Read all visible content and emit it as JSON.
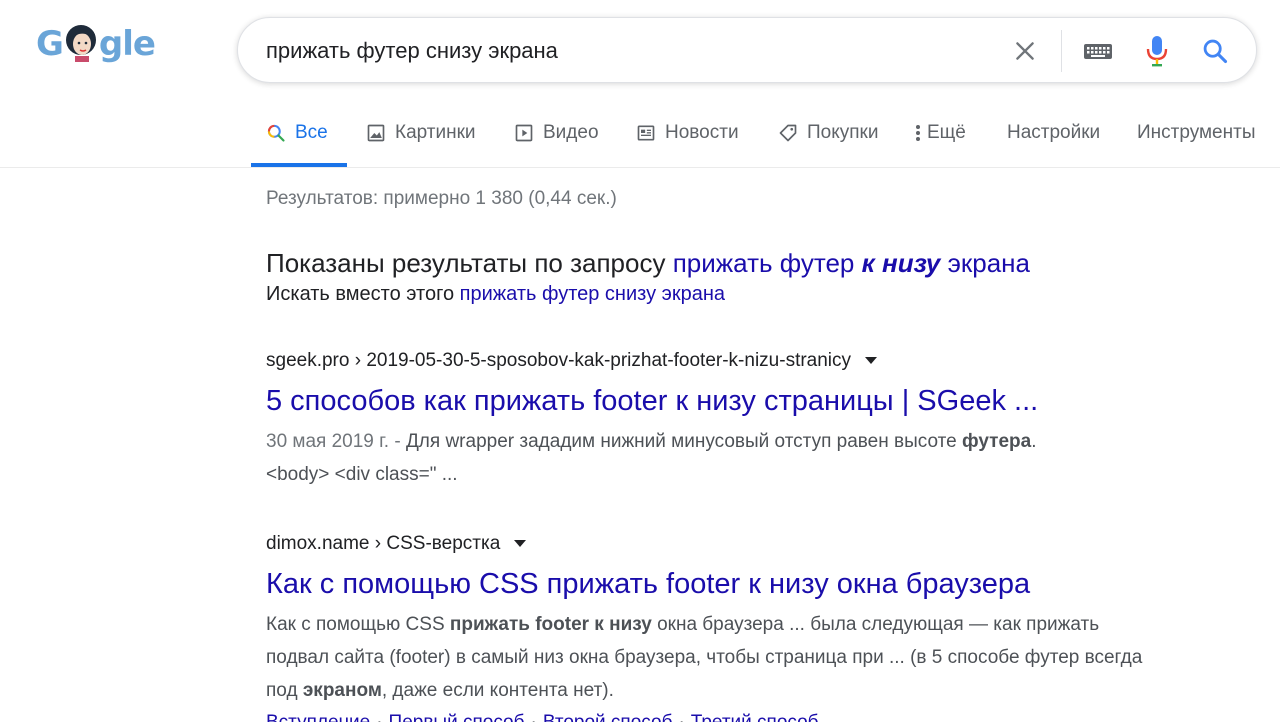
{
  "logo": {
    "g1": "G",
    "gl": "gl",
    "e": "e"
  },
  "search": {
    "query": "прижать футер снизу экрана"
  },
  "tabs": [
    {
      "label": "Все",
      "icon": "search-icon"
    },
    {
      "label": "Картинки",
      "icon": "image-icon"
    },
    {
      "label": "Видео",
      "icon": "video-icon"
    },
    {
      "label": "Новости",
      "icon": "news-icon"
    },
    {
      "label": "Покупки",
      "icon": "tag-icon"
    },
    {
      "label": "Ещё",
      "icon": "more-vert-icon"
    },
    {
      "label": "Настройки"
    },
    {
      "label": "Инструменты"
    }
  ],
  "stats": "Результатов: примерно 1 380 (0,44 сек.)",
  "spell": {
    "shown_prefix": "Показаны результаты по запросу",
    "corrected_a": "прижать футер",
    "corrected_b": "к низу",
    "corrected_c": "экрана",
    "instead_prefix": "Искать вместо этого",
    "original": "прижать футер снизу экрана"
  },
  "results": [
    {
      "cite": "sgeek.pro › 2019-05-30-5-sposobov-kak-prizhat-footer-k-nizu-stranicy",
      "title": "5 способов как прижать footer к низу страницы | SGeek ...",
      "date": "30 мая 2019 г. -",
      "snippet_a": "Для wrapper зададим нижний минусовый отступ равен высоте",
      "snippet_b": "футера",
      "snippet_c": ".",
      "snippet_d": "<body> <div class=\" ..."
    },
    {
      "cite": "dimox.name › CSS-верстка",
      "title": "Как с помощью CSS прижать footer к низу окна браузера",
      "snippet_a": "Как с помощью CSS",
      "snippet_b": "прижать footer к низу",
      "snippet_c": "окна браузера ... была следующая — как прижать подвал сайта (footer) в самый низ окна браузера, чтобы страница при ... (в 5 способе футер всегда под",
      "snippet_d": "экраном",
      "snippet_e": ", даже если контента нет).",
      "sitelinks": [
        "Вступление",
        "Первый способ",
        "Второй способ",
        "Третий способ"
      ],
      "sitelink_sep": "·"
    }
  ],
  "colors": {
    "link": "#1a0dab",
    "accent": "#1a73e8",
    "text": "#202124",
    "muted": "#70757a"
  }
}
